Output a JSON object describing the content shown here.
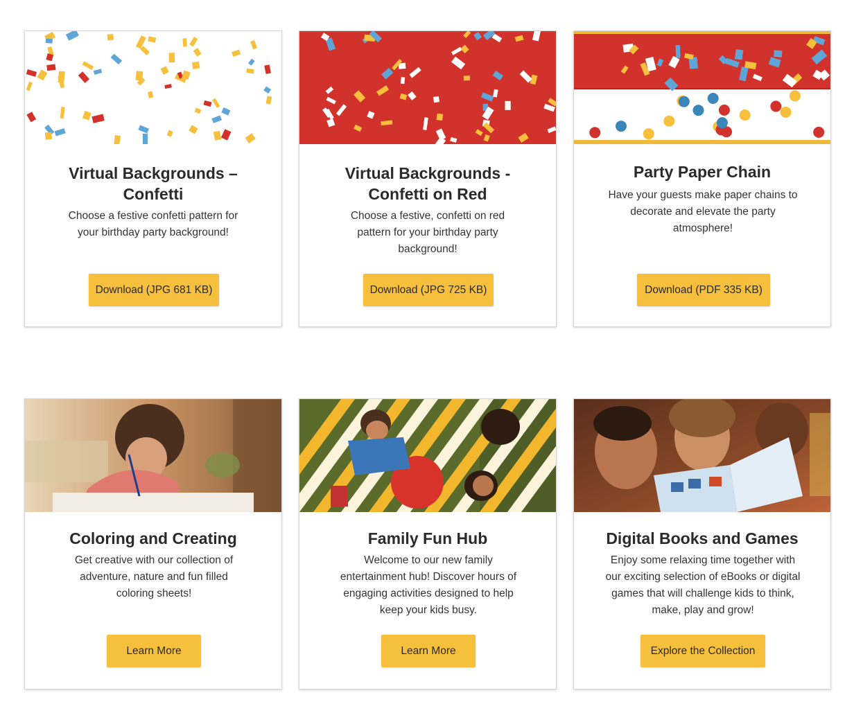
{
  "cards": [
    {
      "image": "confetti-white-pattern",
      "title": "Virtual Backgrounds –\nConfetti",
      "description": "Choose a festive confetti pattern for your birthday party background!",
      "button": "Download (JPG 681 KB)"
    },
    {
      "image": "confetti-red-pattern",
      "title": "Virtual Backgrounds -\nConfetti on Red",
      "description": "Choose a festive, confetti on red pattern for your birthday party background!",
      "button": "Download (JPG 725 KB)"
    },
    {
      "image": "paper-chain-pattern",
      "title": "Party Paper Chain",
      "description": "Have your guests make paper chains to decorate and elevate the party atmosphere!",
      "button": "Download (PDF 335 KB)"
    },
    {
      "image": "girl-coloring-photo",
      "title": "Coloring and Creating",
      "description": "Get creative with our collection of adventure, nature and fun filled coloring sheets!",
      "button": "Learn More"
    },
    {
      "image": "family-picnic-photo",
      "title": "Family Fun Hub",
      "description": "Welcome to our new family entertainment hub! Discover hours of engaging activities designed to help keep your kids busy.",
      "button": "Learn More"
    },
    {
      "image": "family-reading-photo",
      "title": "Digital Books and Games",
      "description": "Enjoy some relaxing time together with our exciting selection of eBooks or digital games that will challenge kids to think, make, play and grow!",
      "button": "Explore the Collection"
    }
  ],
  "colors": {
    "accent_yellow": "#f6bf3c",
    "confetti_red": "#d1322c",
    "confetti_blue": "#5fa6d6",
    "card_border": "#d6d6d6"
  }
}
